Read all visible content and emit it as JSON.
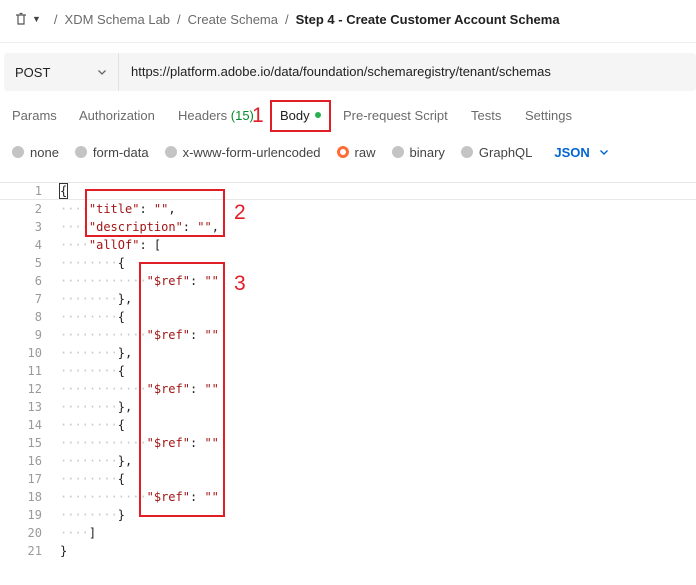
{
  "breadcrumb": {
    "items": [
      "XDM Schema Lab",
      "Create Schema"
    ],
    "current": "Step 4 - Create Customer Account Schema",
    "separator": "/"
  },
  "request": {
    "method": "POST",
    "url": "https://platform.adobe.io/data/foundation/schemaregistry/tenant/schemas"
  },
  "tabs": {
    "params": "Params",
    "authorization": "Authorization",
    "headers": "Headers",
    "headers_count": "(15)",
    "body": "Body",
    "prerequest": "Pre-request Script",
    "tests": "Tests",
    "settings": "Settings"
  },
  "body_types": {
    "options": [
      "none",
      "form-data",
      "x-www-form-urlencoded",
      "raw",
      "binary",
      "GraphQL"
    ],
    "selected": "raw",
    "format": "JSON"
  },
  "editor": {
    "lines": [
      {
        "n": "1",
        "code": "{"
      },
      {
        "n": "2",
        "code": "\"title\": \"\","
      },
      {
        "n": "3",
        "code": "\"description\": \"\","
      },
      {
        "n": "4",
        "code": "\"allOf\": ["
      },
      {
        "n": "5",
        "code": "{"
      },
      {
        "n": "6",
        "code": "\"$ref\": \"\""
      },
      {
        "n": "7",
        "code": "},"
      },
      {
        "n": "8",
        "code": "{"
      },
      {
        "n": "9",
        "code": "\"$ref\": \"\""
      },
      {
        "n": "10",
        "code": "},"
      },
      {
        "n": "11",
        "code": "{"
      },
      {
        "n": "12",
        "code": "\"$ref\": \"\""
      },
      {
        "n": "13",
        "code": "},"
      },
      {
        "n": "14",
        "code": "{"
      },
      {
        "n": "15",
        "code": "\"$ref\": \"\""
      },
      {
        "n": "16",
        "code": "},"
      },
      {
        "n": "17",
        "code": "{"
      },
      {
        "n": "18",
        "code": "\"$ref\": \"\""
      },
      {
        "n": "19",
        "code": "}"
      },
      {
        "n": "20",
        "code": "]"
      },
      {
        "n": "21",
        "code": "}"
      }
    ]
  },
  "annotations": {
    "one": "1",
    "two": "2",
    "three": "3"
  },
  "colors": {
    "accent_orange": "#ff6c37",
    "link_blue": "#0265d2",
    "annotation_red": "#e11d26",
    "status_green": "#26b14c"
  }
}
